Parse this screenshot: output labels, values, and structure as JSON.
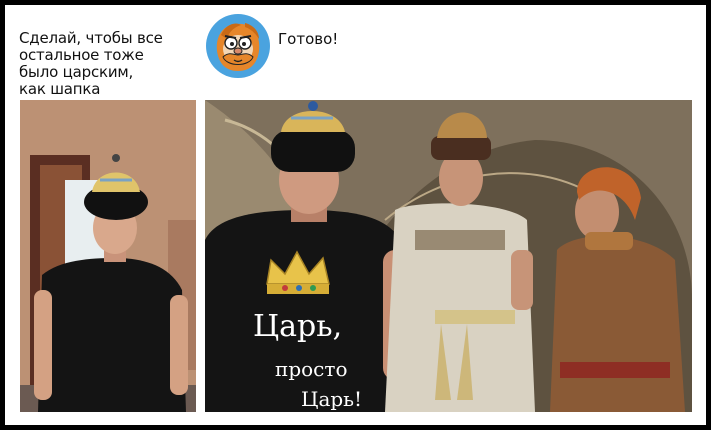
{
  "request": {
    "text": "Сделай, чтобы все\nостальное тоже\nбыло царским,\nкак шапка"
  },
  "reply": {
    "text": "Готово!"
  },
  "shirt": {
    "line1": "Царь,",
    "line2": "просто",
    "line3": "Царь!"
  },
  "colors": {
    "avatar_bg": "#4aa3df",
    "avatar_fur": "#e6862a",
    "wall_left": "#b88b6e",
    "shirt": "#141414",
    "crown": "#e8c34a"
  },
  "icons": [
    "bot-avatar-icon"
  ]
}
